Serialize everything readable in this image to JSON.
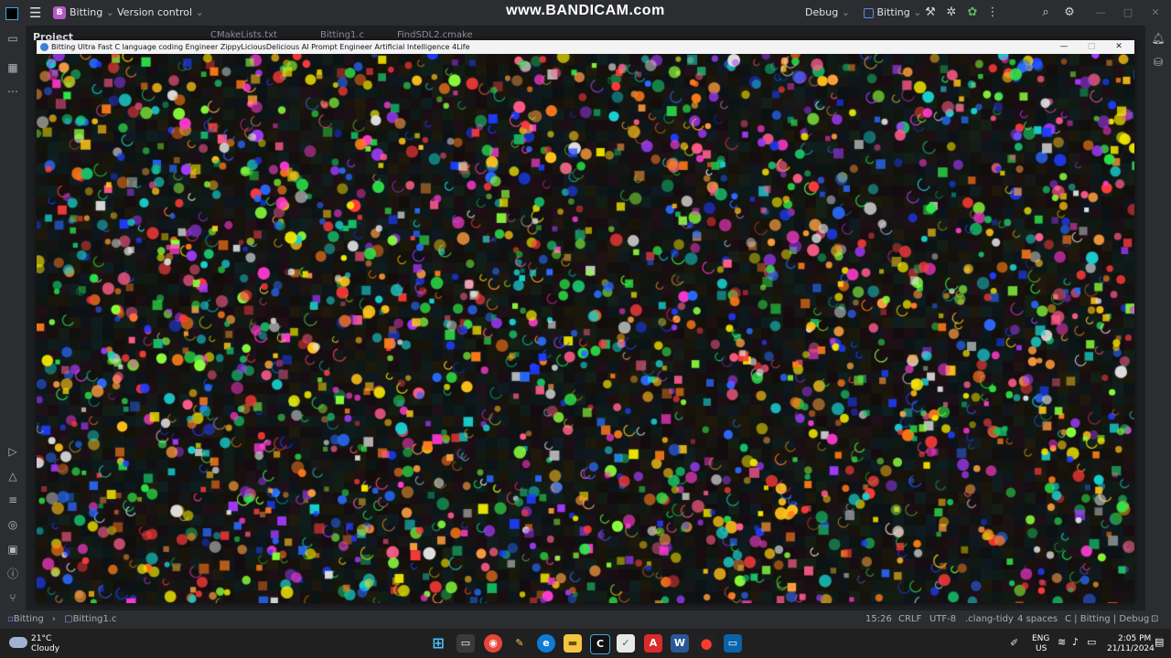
{
  "ide": {
    "project_badge": "B",
    "project_name": "Bitting",
    "vcs_menu": "Version control",
    "build_config": "Debug",
    "run_target": "Bitting",
    "tool_window_label": "Project",
    "tabs": [
      "CMakeLists.txt",
      "Bitting1.c",
      "FindSDL2.cmake"
    ]
  },
  "watermark": "www.BANDICAM.com",
  "app_window": {
    "title": "Bitting Ultra Fast  C language coding  Engineer  ZippyLiciousDelicious  AI Prompt  Engineer  Artificial  Intelligence  4Life",
    "min_label": "—",
    "max_label": "□",
    "close_label": "✕"
  },
  "statusbar": {
    "breadcrumb_project": "Bitting",
    "breadcrumb_file": "Bitting1.c",
    "position": "15:26",
    "line_ending": "CRLF",
    "encoding": "UTF-8",
    "linter": ".clang-tidy",
    "indent": "4 spaces",
    "context": "C | Bitting | Debug"
  },
  "taskbar": {
    "temperature": "21°C",
    "weather": "Cloudy",
    "lang_top": "ENG",
    "lang_bottom": "US",
    "time": "2:05 PM",
    "date": "21/11/2024"
  },
  "colors": {
    "ide_bg": "#1e1f22",
    "ide_panel": "#2b2d30",
    "project_badge": "#b55ac9",
    "taskbar": "#202020"
  }
}
